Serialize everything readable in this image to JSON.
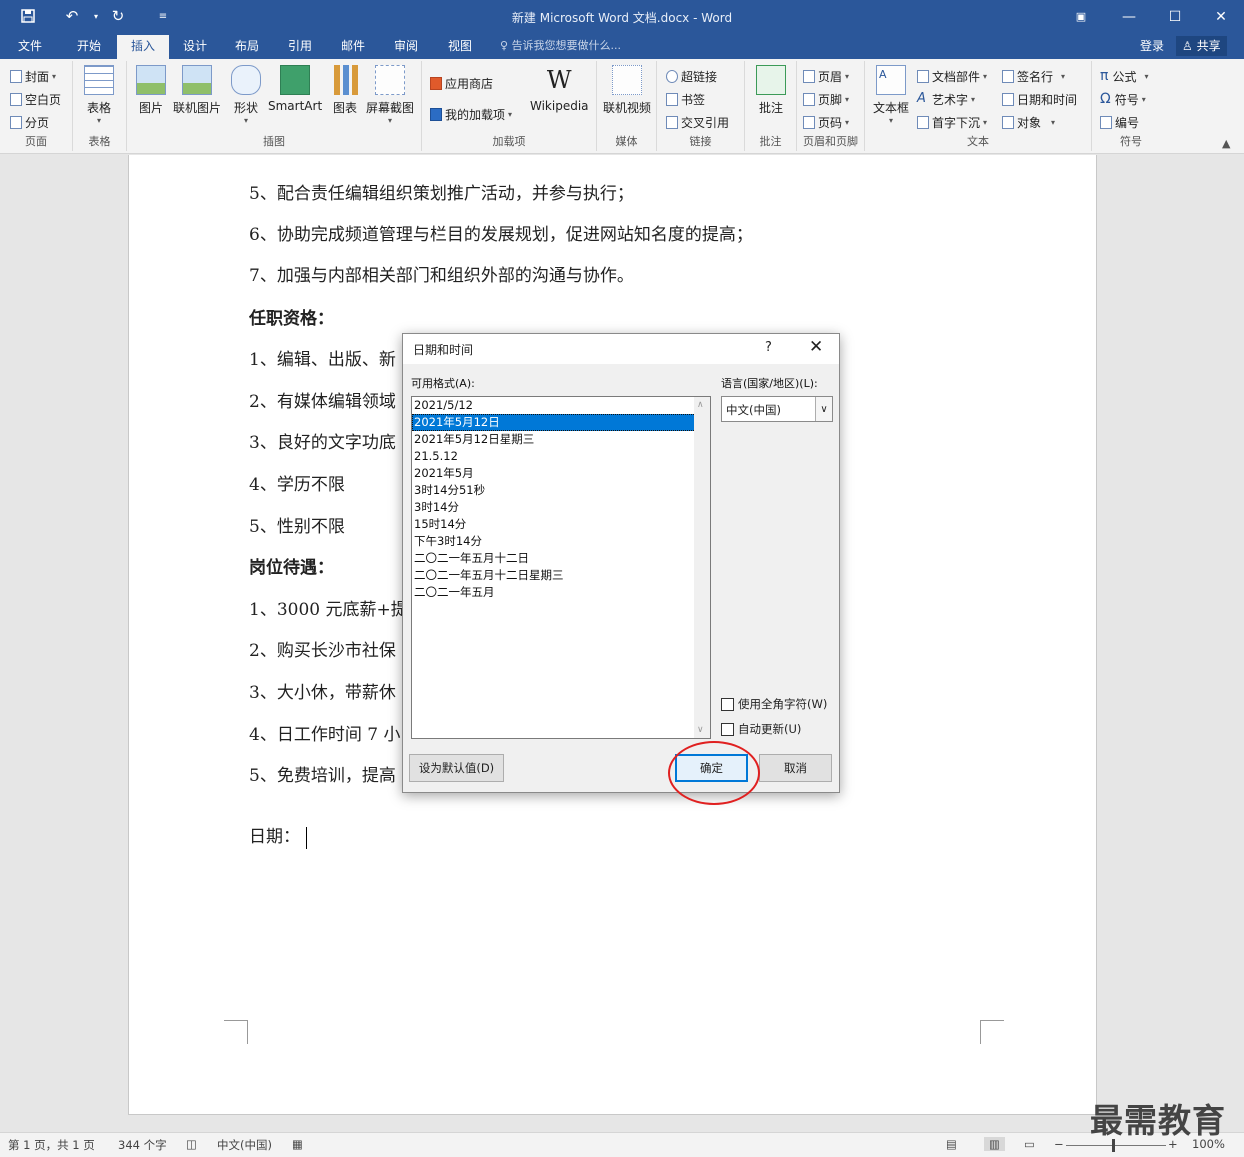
{
  "titlebar": {
    "title": "新建 Microsoft Word 文档.docx - Word",
    "quick_access": [
      "save-icon",
      "undo-icon",
      "redo-icon",
      "customize-icon"
    ]
  },
  "tabs": [
    "文件",
    "开始",
    "插入",
    "设计",
    "布局",
    "引用",
    "邮件",
    "审阅",
    "视图"
  ],
  "active_tab": "插入",
  "tell_me": "告诉我您想要做什么...",
  "login": "登录",
  "share": "共享",
  "ribbon": {
    "pages": {
      "label": "页面",
      "items": [
        "封面",
        "空白页",
        "分页"
      ]
    },
    "tables": {
      "label": "表格",
      "item": "表格"
    },
    "illustrations": {
      "label": "插图",
      "items": [
        "图片",
        "联机图片",
        "形状",
        "SmartArt",
        "图表",
        "屏幕截图"
      ]
    },
    "addins": {
      "label": "加载项",
      "items": [
        "应用商店",
        "我的加载项",
        "Wikipedia"
      ]
    },
    "media": {
      "label": "媒体",
      "item": "联机视频"
    },
    "links": {
      "label": "链接",
      "items": [
        "超链接",
        "书签",
        "交叉引用"
      ]
    },
    "comments": {
      "label": "批注",
      "item": "批注"
    },
    "headerfooter": {
      "label": "页眉和页脚",
      "items": [
        "页眉",
        "页脚",
        "页码"
      ]
    },
    "text": {
      "label": "文本",
      "textbox": "文本框",
      "items": [
        "文档部件",
        "艺术字",
        "首字下沉",
        "签名行",
        "日期和时间",
        "对象"
      ]
    },
    "symbols": {
      "label": "符号",
      "items": [
        "公式",
        "符号",
        "编号"
      ]
    }
  },
  "document": {
    "lines": [
      "5、配合责任编辑组织策划推广活动，并参与执行；",
      "6、协助完成频道管理与栏目的发展规划，促进网站知名度的提高；",
      "7、加强与内部相关部门和组织外部的沟通与协作。",
      "任职资格：",
      "1、编辑、出版、新",
      "2、有媒体编辑领域",
      "3、良好的文字功底",
      "4、学历不限",
      "5、性别不限",
      "岗位待遇：",
      "1、3000 元底薪+提",
      "2、购买长沙市社保",
      "3、大小休，带薪休",
      "4、日工作时间 7 小",
      "5、免费培训，提高"
    ],
    "date_line": "日期："
  },
  "dialog": {
    "title": "日期和时间",
    "help": "?",
    "formats_label": "可用格式(A):",
    "formats": [
      "2021/5/12",
      "2021年5月12日",
      "2021年5月12日星期三",
      "21.5.12",
      "2021年5月",
      "3时14分51秒",
      "3时14分",
      "15时14分",
      "下午3时14分",
      "二〇二一年五月十二日",
      "二〇二一年五月十二日星期三",
      "二〇二一年五月"
    ],
    "selected_index": 1,
    "language_label": "语言(国家/地区)(L):",
    "language_value": "中文(中国)",
    "fullwidth_label": "使用全角字符(W)",
    "autoupdate_label": "自动更新(U)",
    "fullwidth_checked": false,
    "autoupdate_checked": false,
    "set_default": "设为默认值(D)",
    "ok": "确定",
    "cancel": "取消"
  },
  "status": {
    "page": "第 1 页，共 1 页",
    "words": "344 个字",
    "language": "中文(中国)",
    "zoom": "100%"
  },
  "watermark": "最需教育"
}
